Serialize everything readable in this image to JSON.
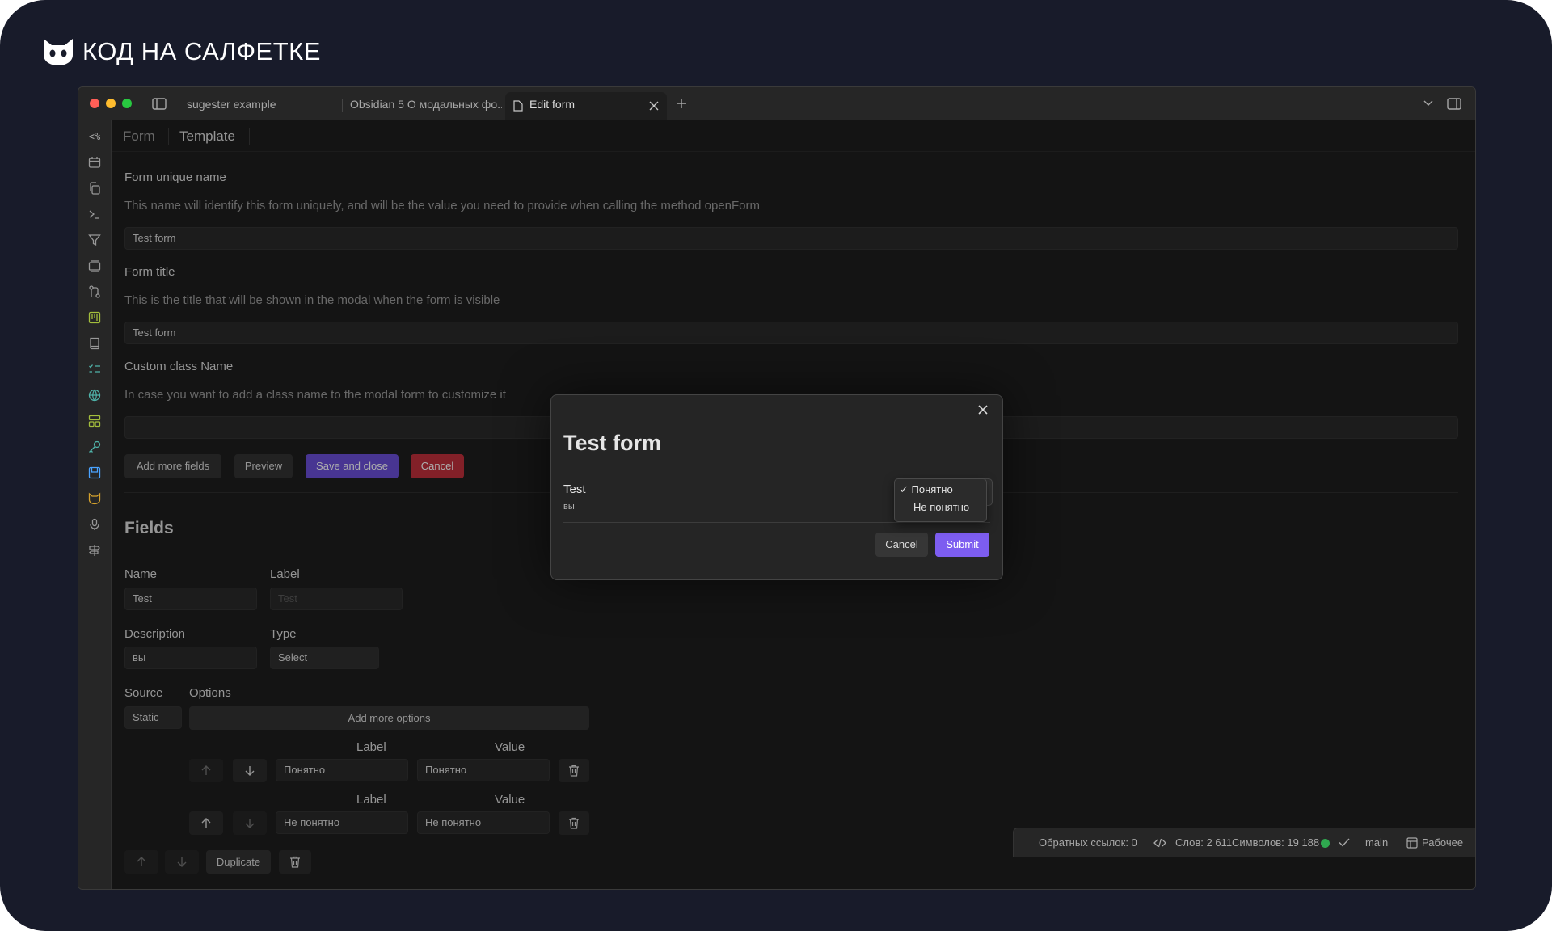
{
  "brand": {
    "text": "КОД НА САЛФЕТКЕ",
    "logo_icon": "cat-head-icon"
  },
  "window": {
    "tabs": [
      {
        "label": "sugester example",
        "active": false
      },
      {
        "label": "Obsidian 5 О модальных фо...",
        "active": false
      },
      {
        "label": "Edit form",
        "active": true
      }
    ]
  },
  "subtabs": [
    "Form",
    "Template"
  ],
  "form": {
    "unique_name": {
      "label": "Form unique name",
      "description": "This name will identify this form uniquely, and will be the value you need to provide when calling the method openForm",
      "value": "Test form"
    },
    "title": {
      "label": "Form title",
      "description": "This is the title that will be shown in the modal when the form is visible",
      "value": "Test form"
    },
    "class_name": {
      "label": "Custom class Name",
      "description": "In case you want to add a class name to the modal form to customize it",
      "value": ""
    },
    "buttons": {
      "add_more_fields": "Add more fields",
      "preview": "Preview",
      "save_and_close": "Save and close",
      "cancel": "Cancel"
    }
  },
  "fields": {
    "heading": "Fields",
    "name_label": "Name",
    "name_value": "Test",
    "label_label": "Label",
    "label_placeholder": "Test",
    "description_label": "Description",
    "description_value": "вы",
    "type_label": "Type",
    "type_value": "Select",
    "source_label": "Source",
    "source_value": "Static",
    "options_label": "Options",
    "add_more_options": "Add more options",
    "options": [
      {
        "label_header": "Label",
        "value_header": "Value",
        "label": "Понятно",
        "value": "Понятно"
      },
      {
        "label_header": "Label",
        "value_header": "Value",
        "label": "Не понятно",
        "value": "Не понятно"
      }
    ],
    "duplicate": "Duplicate"
  },
  "modal": {
    "title": "Test form",
    "field_name": "Test",
    "field_description": "вы",
    "dropdown_options": [
      {
        "label": "Понятно",
        "selected": true,
        "check": "✓"
      },
      {
        "label": "Не понятно",
        "selected": false,
        "check": ""
      }
    ],
    "cancel": "Cancel",
    "submit": "Submit"
  },
  "statusbar": {
    "backlinks": "Обратных ссылок: 0",
    "words": "Слов: 2 611",
    "chars": "Символов: 19 188",
    "branch": "main",
    "vault": "Рабочее"
  },
  "colors": {
    "accent": "#6b4fd8",
    "submit": "#7d5df0",
    "danger": "#c0303b",
    "background": "#1e1e1e",
    "frame": "#181b2a"
  }
}
